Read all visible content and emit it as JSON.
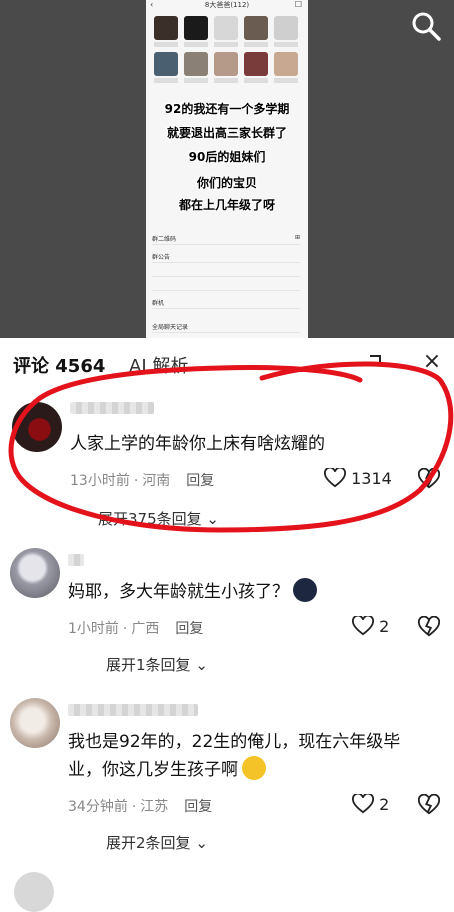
{
  "video": {
    "phone_header": "8大爸爸(112)",
    "caption_lines": [
      "92的我还有一个多学期",
      "就要退出高三家长群了",
      "90后的姐妹们",
      "你们的宝贝",
      "都在上几年级了呀"
    ],
    "phone_rows": [
      {
        "label": "群二维码",
        "right": "⊞"
      },
      {
        "label": "群公告",
        "right": ""
      },
      {
        "label": "",
        "right": ""
      },
      {
        "label": "",
        "right": ""
      },
      {
        "label": "群机",
        "right": ""
      },
      {
        "label": "全局聊天记录",
        "right": ""
      }
    ]
  },
  "sheet": {
    "tab_comments": "评论 4564",
    "tab_ai": "AI 解析"
  },
  "comments": [
    {
      "text": "人家上学的年龄你上床有啥炫耀的",
      "time": "13小时前",
      "location": "河南",
      "reply": "回复",
      "likes": "1314",
      "more": "展开375条回复",
      "avatar_colors": [
        "#2b1a1a",
        "#7a1010",
        "#140c0c"
      ]
    },
    {
      "text": "妈耶，多大年龄就生小孩了？",
      "time": "1小时前",
      "location": "广西",
      "reply": "回复",
      "likes": "2",
      "more": "展开1条回复",
      "avatar_colors": [
        "#d8d8dc",
        "#9a9aa6",
        "#5a5a64"
      ]
    },
    {
      "text": "我也是92年的，22生的俺儿，现在六年级毕业，你这几岁生孩子啊",
      "time": "34分钟前",
      "location": "江苏",
      "reply": "回复",
      "likes": "2",
      "more": "展开2条回复",
      "avatar_colors": [
        "#efe8e2",
        "#c9b8ac",
        "#8a7468"
      ]
    }
  ],
  "colors": {
    "annotation": "#e3121b",
    "video_bg": "#4a4a4a"
  }
}
